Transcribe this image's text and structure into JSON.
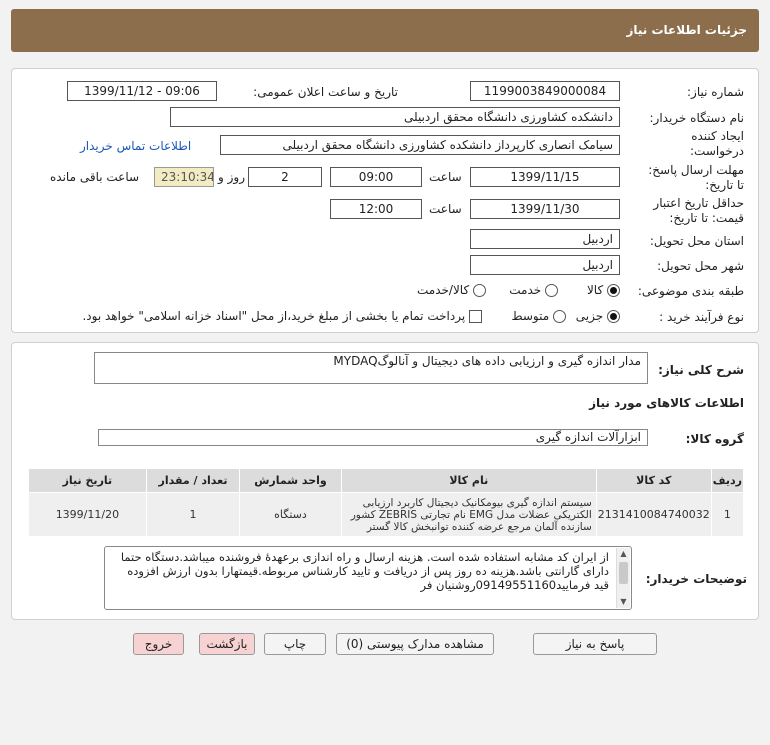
{
  "page": {
    "title": "جزئیات اطلاعات نیاز"
  },
  "form": {
    "need_number_label": "شماره نیاز:",
    "need_number": "1199003849000084",
    "announce_label": "تاریخ و ساعت اعلان عمومی:",
    "announce_value": "1399/11/12 - 09:06",
    "buyer_label": "نام دستگاه خریدار:",
    "buyer_value": "دانشکده کشاورزی دانشگاه محقق اردبیلی",
    "creator_label_1": "ایجاد کننده",
    "creator_label_2": "درخواست:",
    "creator_value": "سیامک انصاری  کارپرداز دانشکده کشاورزی دانشگاه محقق اردبیلی",
    "contact_link": "اطلاعات تماس خریدار",
    "deadline_label_1": "مهلت ارسال پاسخ:",
    "deadline_label_2": "تا تاریخ:",
    "deadline_date": "1399/11/15",
    "time_label": "ساعت",
    "deadline_time": "09:00",
    "days_value": "2",
    "days_label": "روز و",
    "remaining_time": "23:10:34",
    "remaining_label": "ساعت باقی مانده",
    "validity_label_1": "حداقل تاریخ اعتبار",
    "validity_label_2": "قیمت: تا تاریخ:",
    "validity_date": "1399/11/30",
    "validity_time_label": "ساعت",
    "validity_time": "12:00",
    "province_label": "استان محل تحویل:",
    "province_value": "اردبیل",
    "city_label": "شهر محل تحویل:",
    "city_value": "اردبیل",
    "category_label": "طبقه بندی موضوعی:",
    "category_options": [
      "کالا",
      "خدمت",
      "کالا/خدمت"
    ],
    "process_label": "نوع فرآیند خرید :",
    "process_options": [
      "جزیی",
      "متوسط"
    ],
    "treasury_note": "پرداخت تمام یا بخشی از مبلغ خرید،از محل \"اسناد خزانه اسلامی\" خواهد بود."
  },
  "summary": {
    "label": "شرح کلی نیاز:",
    "value": "مدار اندازه گیری و ارزیابی داده های دیجیتال و آنالوگMYDAQ"
  },
  "goods": {
    "section_title": "اطلاعات کالاهای مورد نیاز",
    "group_label": "گروه کالا:",
    "group_value": "ابزارآلات اندازه گیری",
    "headers": [
      "ردیف",
      "کد کالا",
      "نام کالا",
      "واحد شمارش",
      "تعداد / مقدار",
      "تاریخ نیاز"
    ],
    "rows": [
      {
        "row": "1",
        "code": "2131410084740032",
        "name": "سیستم اندازه گیری بیومکانیک دیجیتال کاربرد ارزیابی الکتریکی عضلات مدل EMG نام تجارتی ZEBRIS کشور سازنده آلمان مرجع عرضه کننده توانبخش کالا گستر",
        "unit": "دستگاه",
        "qty": "1",
        "date": "1399/11/20"
      }
    ]
  },
  "notes": {
    "label": "توضیحات خریدار:",
    "text": "از ایران کد مشابه استفاده شده است. هزینه ارسال و راه اندازی برعهدۀ فروشنده میباشد.دستگاه حتما دارای گارانتی باشد.هزینه ده روز پس از دریافت و تایید کارشناس مربوطه.قیمتهارا بدون ارزش افزوده قید فرمایید09149551160روشنیان فر"
  },
  "buttons": {
    "reply": "پاسخ به نیاز",
    "attachments": "مشاهده مدارک پیوستی (0)",
    "print": "چاپ",
    "back": "بازگشت",
    "exit": "خروج"
  }
}
